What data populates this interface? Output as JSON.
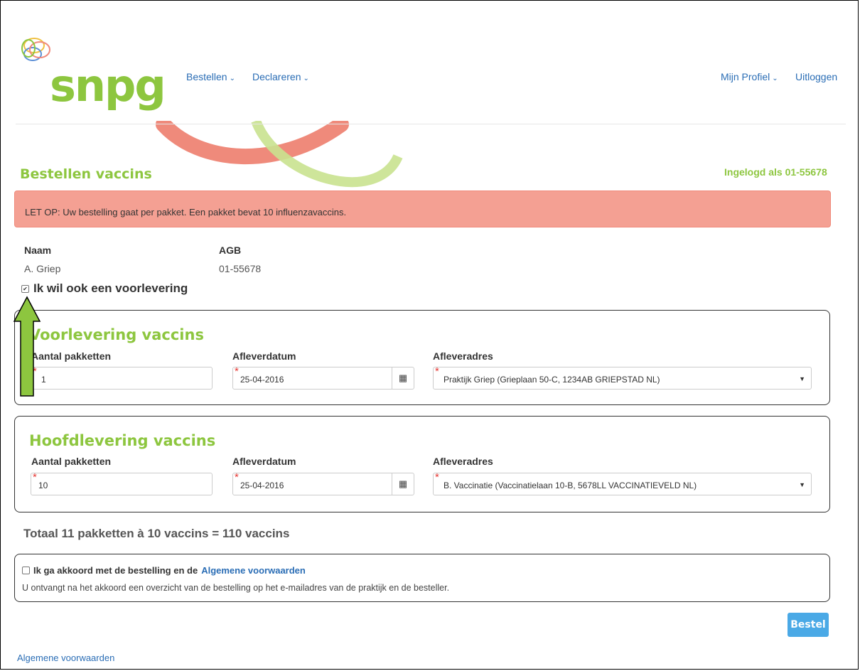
{
  "brand": {
    "name": "snpg"
  },
  "nav": {
    "left": [
      {
        "label": "Bestellen"
      },
      {
        "label": "Declareren"
      }
    ],
    "right": {
      "profile_label": "Mijn Profiel",
      "logout_label": "Uitloggen"
    }
  },
  "page": {
    "title": "Bestellen vaccins",
    "logged_in": "Ingelogd als 01-55678"
  },
  "alert": {
    "text": "LET OP: Uw bestelling gaat per pakket. Een pakket bevat 10 influenzavaccins."
  },
  "customer": {
    "name_label": "Naam",
    "name_value": "A. Griep",
    "agb_label": "AGB",
    "agb_value": "01-55678"
  },
  "preorder_checkbox": {
    "label": "Ik wil ook een voorlevering",
    "checked": true
  },
  "voorlevering": {
    "title": "Voorlevering vaccins",
    "qty_label": "Aantal pakketten",
    "qty_value": "1",
    "date_label": "Afleverdatum",
    "date_value": "25-04-2016",
    "address_label": "Afleveradres",
    "address_value": "Praktijk Griep (Grieplaan 50-C, 1234AB GRIEPSTAD NL)"
  },
  "hoofdlevering": {
    "title": "Hoofdlevering vaccins",
    "qty_label": "Aantal pakketten",
    "qty_value": "10",
    "date_label": "Afleverdatum",
    "date_value": "25-04-2016",
    "address_label": "Afleveradres",
    "address_value": "B. Vaccinatie (Vaccinatielaan 10-B, 5678LL VACCINATIEVELD NL)"
  },
  "total": {
    "text": "Totaal 11 pakketten à 10 vaccins = 110 vaccins"
  },
  "agreement": {
    "label_prefix": "Ik ga akkoord met de bestelling en de",
    "link_label": "Algemene voorwaarden",
    "note": "U ontvangt na het akkoord een overzicht van de bestelling op het e-mailadres van de praktijk en de besteller.",
    "checked": false
  },
  "order_button": {
    "label": "Bestel"
  },
  "footer": {
    "link_label": "Algemene voorwaarden"
  },
  "colors": {
    "brand_green": "#8dc63f",
    "alert_bg": "#f4a093",
    "link_blue": "#2a6db5",
    "button_blue": "#4aa9e6",
    "arrow_green": "#8dc63f"
  },
  "icons": {
    "calendar": "calendar-icon",
    "dropdown": "chevron-down-icon",
    "arrow": "up-arrow-annotation"
  }
}
